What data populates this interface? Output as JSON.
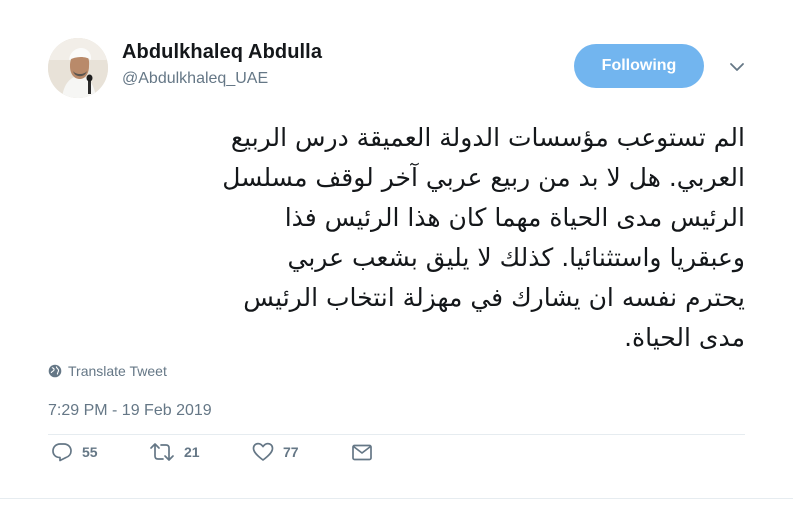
{
  "author": {
    "name": "Abdulkhaleq Abdulla",
    "handle": "@Abdulkhaleq_UAE",
    "avatar_icon": "profile-photo"
  },
  "follow_button": {
    "label": "Following",
    "color": "#72b5ef"
  },
  "menu_icon": "chevron-down-icon",
  "tweet": {
    "lines": [
      "الم تستوعب مؤسسات الدولة العميقة درس الربيع",
      "العربي. هل لا بد من ربيع عربي آخر لوقف مسلسل",
      "الرئيس مدى الحياة مهما كان هذا الرئيس فذا",
      "وعبقريا واستثنائيا. كذلك لا يليق بشعب عربي",
      "يحترم نفسه ان يشارك في مهزلة انتخاب الرئيس",
      "مدى الحياة."
    ]
  },
  "translate": {
    "label": "Translate Tweet",
    "icon": "globe-icon"
  },
  "timestamp": "7:29 PM - 19 Feb 2019",
  "actions": {
    "reply": {
      "icon": "reply-icon",
      "count": "55"
    },
    "retweet": {
      "icon": "retweet-icon",
      "count": "21"
    },
    "like": {
      "icon": "heart-icon",
      "count": "77"
    },
    "message": {
      "icon": "envelope-icon"
    }
  },
  "colors": {
    "text": "#14171a",
    "secondary": "#657786",
    "accent": "#72b5ef"
  }
}
